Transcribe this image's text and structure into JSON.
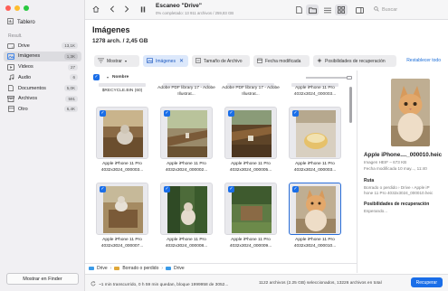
{
  "window": {
    "traffic_lights": [
      "close",
      "minimize",
      "zoom"
    ]
  },
  "sidebar": {
    "dashboard_label": "Tablero",
    "section_label": "Result.",
    "items": [
      {
        "label": "Drive",
        "count": "13,1K",
        "icon": "drive-icon",
        "active": false
      },
      {
        "label": "Imágenes",
        "count": "1,3K",
        "icon": "images-icon",
        "active": true
      },
      {
        "label": "Videos",
        "count": "27",
        "icon": "video-icon",
        "active": false
      },
      {
        "label": "Audio",
        "count": "6",
        "icon": "audio-icon",
        "active": false
      },
      {
        "label": "Documentos",
        "count": "5,0K",
        "icon": "documents-icon",
        "active": false
      },
      {
        "label": "Archivos",
        "count": "591",
        "icon": "archives-icon",
        "active": false
      },
      {
        "label": "Otro",
        "count": "6,4K",
        "icon": "other-icon",
        "active": false
      }
    ],
    "finder_button": "Mostrar en Finder"
  },
  "toolbar": {
    "scan_title": "Escaneo \"Drive\"",
    "scan_subtitle": "0% completado: 13 911 archivos / 259,83 GB",
    "search_placeholder": "Buscar"
  },
  "content": {
    "title": "Imágenes",
    "subtitle": "1278 arch. / 2,45 GB"
  },
  "filters": {
    "show_label": "Mostrar",
    "images_chip": "Imágenes",
    "size_chip": "Tamaño de Archivo",
    "date_chip": "Fecha modificada",
    "recovery_chip": "Posibilidades de recuperación",
    "reset": "Restablecer todo"
  },
  "list": {
    "column_name": "Nombre",
    "top_row": [
      "$RECYCLE.BIN (60)",
      "Adobe PDF library 17 - Adobe Illustrat...",
      "Adobe PDF library 17 - Adobe Illustrat...",
      "Apple iPhone 11 Pro 4032x3024_000003..."
    ],
    "rows": [
      [
        {
          "line1": "Apple iPhone 11 Pro",
          "line2": "4032x3024_000003...",
          "selected": false,
          "scene": "cat-wood"
        },
        {
          "line1": "Apple iPhone 11 Pro",
          "line2": "4032x3024_000002...",
          "selected": false,
          "scene": "wood"
        },
        {
          "line1": "Apple iPhone 11 Pro",
          "line2": "4032x3024_000005...",
          "selected": false,
          "scene": "wood-dark"
        },
        {
          "line1": "Apple iPhone 11 Pro",
          "line2": "4032x3024_000003...",
          "selected": false,
          "scene": "bowl"
        }
      ],
      [
        {
          "line1": "Apple iPhone 11 Pro",
          "line2": "4032x3024_000007...",
          "selected": false,
          "scene": "cat-wood"
        },
        {
          "line1": "Apple iPhone 11 Pro",
          "line2": "4032x3024_000008...",
          "selected": false,
          "scene": "cat-garden"
        },
        {
          "line1": "Apple iPhone 11 Pro",
          "line2": "4032x3024_000009...",
          "selected": false,
          "scene": "garden"
        },
        {
          "line1": "Apple iPhone 11 Pro",
          "line2": "4032x3024_000010...",
          "selected": true,
          "scene": "kitten"
        }
      ]
    ]
  },
  "pathbar": {
    "items": [
      "Drive",
      "Borrado o perdido",
      "Drive"
    ]
  },
  "status": {
    "left": "~1 min transcurrido, 0 h 59 min quedan, bloque 1999958 de 3052...",
    "middle": "1122 archivos (2.25 GB) seleccionados, 13226 archivos en total",
    "recover_button": "Recuperar"
  },
  "preview": {
    "file_name": "Apple iPhone...._000010.heic",
    "type_size": "Imagen HEIF – 673 KB",
    "modified": "Fecha modificada 10 may..., 11:40",
    "route_heading": "Ruta",
    "route_value": "Borrado o perdido › Drive › Apple iP",
    "route_value2": "hone 11 Pro 4032x3024_000010.heic",
    "recovery_heading": "Posibilidades de recuperación",
    "recovery_value": "Esperando..."
  },
  "colors": {
    "accent": "#1a6ee8",
    "sidebar_bg": "#f1f0f3",
    "selection_chip": "#dce8fb"
  }
}
